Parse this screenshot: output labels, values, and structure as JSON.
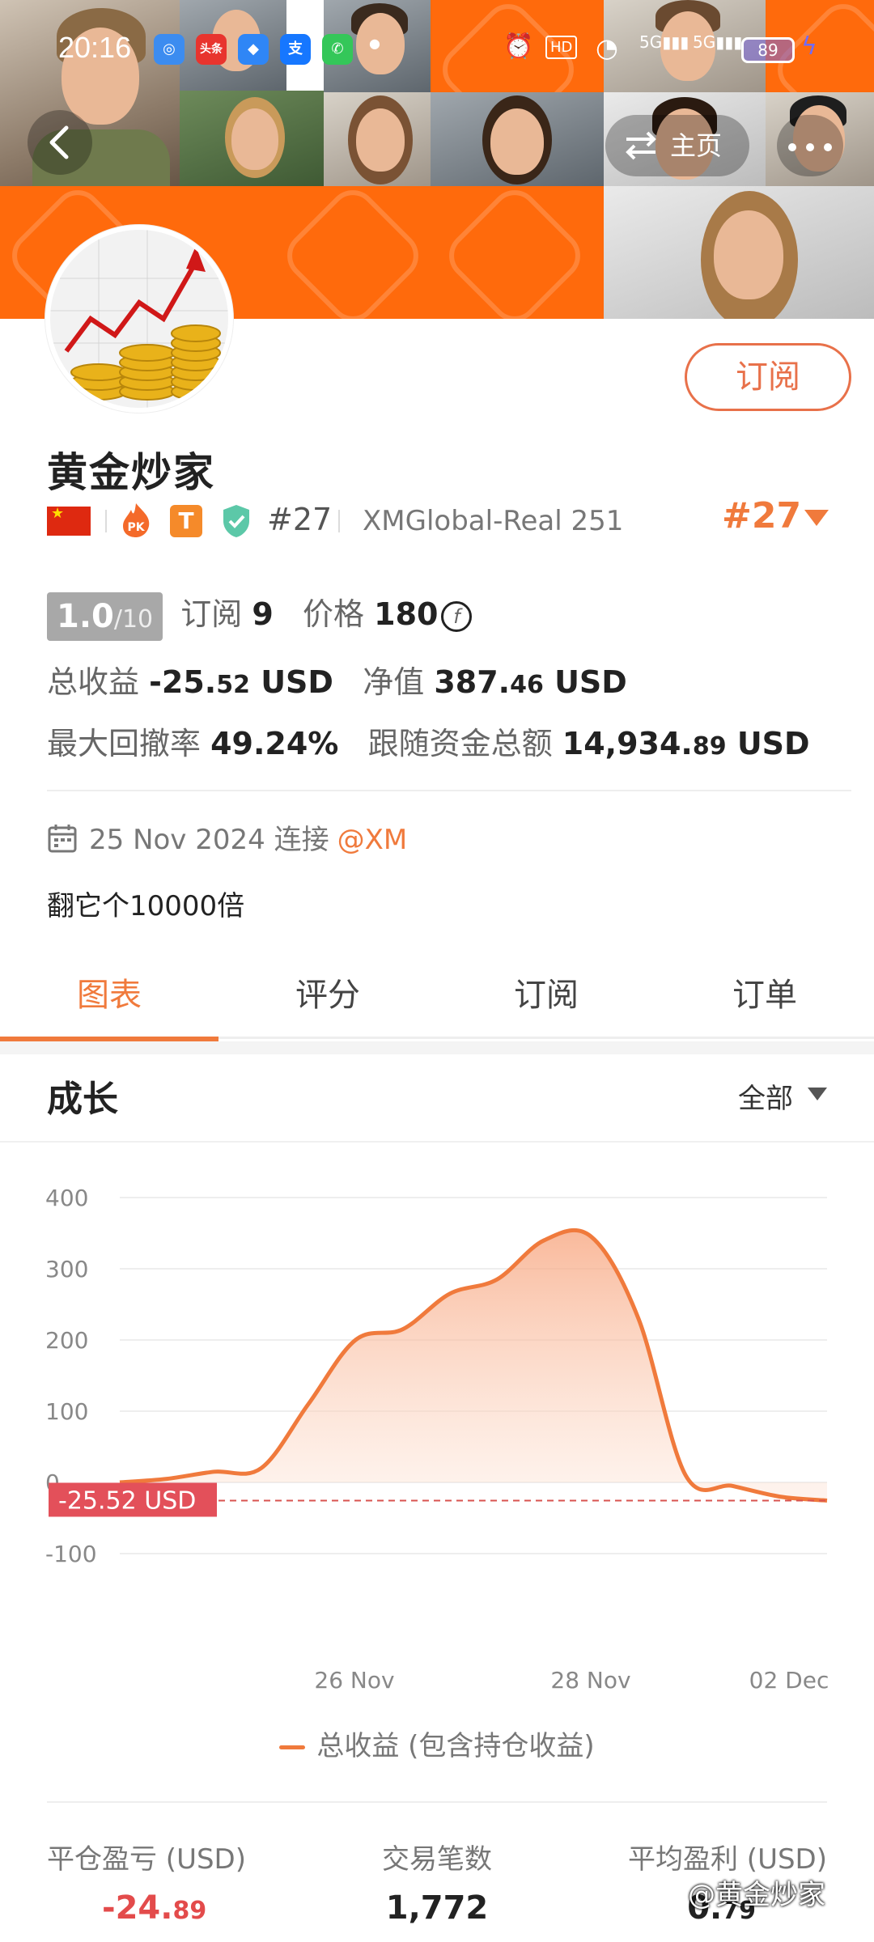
{
  "status_bar": {
    "time": "20:16",
    "app_icons": [
      "头条",
      "支"
    ],
    "network": "HD 5G 5G",
    "battery": "89"
  },
  "nav": {
    "home_label": "主页"
  },
  "profile": {
    "name": "黄金炒家",
    "subscribe_label": "订阅",
    "rank_small": "#27",
    "account": "XMGlobal-Real 251",
    "rank_large": "#27",
    "t_badge": "T",
    "pk_badge": "PK"
  },
  "stats": {
    "rating_int": "1.0",
    "rating_den": "/10",
    "subscribers_label": "订阅",
    "subscribers": "9",
    "price_label": "价格",
    "price": "180",
    "total_profit_label": "总收益",
    "total_profit_main": "-25.",
    "total_profit_dec": "52",
    "total_profit_unit": "USD",
    "equity_label": "净值",
    "equity_main": "387.",
    "equity_dec": "46",
    "equity_unit": "USD",
    "drawdown_label": "最大回撤率",
    "drawdown": "49.24%",
    "follow_funds_label": "跟随资金总额",
    "follow_funds_main": "14,934.",
    "follow_funds_dec": "89",
    "follow_funds_unit": "USD"
  },
  "connection": {
    "date": "25 Nov 2024",
    "text": "连接",
    "broker": "@XM"
  },
  "bio": "翻它个10000倍",
  "tabs": [
    "图表",
    "评分",
    "订阅",
    "订单"
  ],
  "growth": {
    "title": "成长",
    "range": "全部"
  },
  "legend": "总收益 (包含持仓收益)",
  "summary": [
    {
      "label": "平仓盈亏 (USD)",
      "main": "-24.",
      "dec": "89",
      "color": "#e34b4b"
    },
    {
      "label": "交易笔数",
      "main": "1,772",
      "dec": "",
      "color": "#222222"
    },
    {
      "label": "平均盈利 (USD)",
      "main": "0.",
      "dec": "79",
      "color": "#222222"
    }
  ],
  "watermark": "@黄金炒家",
  "colors": {
    "accent": "#f07a3c",
    "negative": "#e34b4b"
  },
  "chart_data": {
    "type": "area",
    "series": [
      {
        "name": "总收益 (包含持仓收益)",
        "x": [
          "25 Nov",
          "25 Nov",
          "25 Nov",
          "26 Nov",
          "26 Nov",
          "26 Nov",
          "27 Nov",
          "27 Nov",
          "27 Nov",
          "28 Nov",
          "28 Nov",
          "29 Nov",
          "29 Nov",
          "30 Nov",
          "01 Dec",
          "02 Dec"
        ],
        "values": [
          0,
          5,
          15,
          20,
          110,
          200,
          215,
          265,
          285,
          340,
          345,
          230,
          10,
          -5,
          -20,
          -25.52
        ]
      }
    ],
    "xticks": [
      "26 Nov",
      "28 Nov",
      "02 Dec"
    ],
    "yticks": [
      400,
      300,
      200,
      100,
      0,
      -100
    ],
    "ylim": [
      -100,
      400
    ],
    "current_value_label": "-25.52 USD",
    "current_value": -25.52,
    "grid": true
  }
}
